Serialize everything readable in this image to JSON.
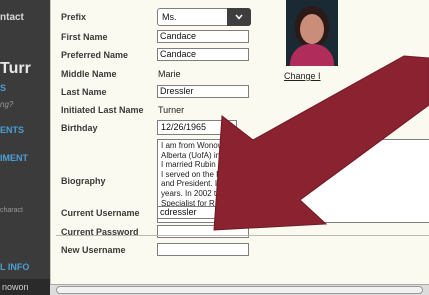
{
  "sidebar": {
    "contact_label": "ntact",
    "name_fragment": "Turr",
    "s_fragment": "S",
    "ing_fragment": "ng?",
    "ents_label": "ENTS",
    "iment_label": "IMENT",
    "charact_fragment": "charact",
    "linfo_label": "L INFO",
    "nowon_fragment": "nowon"
  },
  "form": {
    "prefix_label": "Prefix",
    "prefix_value": "Ms.",
    "first_name_label": "First Name",
    "first_name_value": "Candace",
    "preferred_name_label": "Preferred Name",
    "preferred_name_value": "Candace",
    "middle_name_label": "Middle Name",
    "middle_name_value": "Marie",
    "last_name_label": "Last Name",
    "last_name_value": "Dressler",
    "initiated_last_name_label": "Initiated Last Name",
    "initiated_last_name_value": "Turner",
    "birthday_label": "Birthday",
    "birthday_value": "12/26/1965",
    "biography_label": "Biography",
    "biography_lines": [
      "I am from Wonowe                                          it to  the Univers",
      "Alberta (UofA) in                                         hapter Secretary.",
      "I married Rubin D",
      "I served on the E                                 Membership Chairman, S",
      "and President. I                                   rotating through all posi",
      "years.  In 2002                                   the Alumnae Program",
      "Specialist for R                                   ing and gardening"
    ],
    "current_username_label": "Current Username",
    "current_username_value": "cdressler",
    "current_password_label": "Current Password",
    "current_password_value": "",
    "new_username_label": "New Username",
    "new_username_value": ""
  },
  "photo": {
    "change_link_label": "Change I"
  },
  "colors": {
    "arrow": "#8b2230",
    "sidebar_bg": "#3b3b3b",
    "sidebar_accent": "#4b9fd6",
    "form_bg": "#fbfaf1"
  }
}
